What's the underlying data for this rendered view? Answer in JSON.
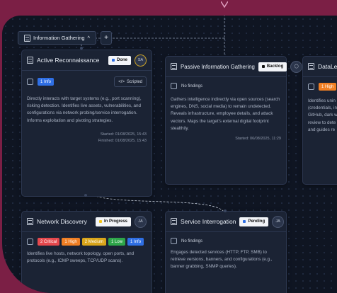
{
  "tab": {
    "label": "Information Gathering",
    "chevron": "^",
    "add": "+"
  },
  "cards": {
    "active": {
      "title": "Active Reconnaissance",
      "status": "Done",
      "avatar": "SA",
      "badge": "1 Info",
      "scripted": "Scripted",
      "desc": "Directly interacts with target systems (e.g., port scanning), risking detection. Identifies live assets, vulnerabilities, and configurations via network probing/service interrogation. Informs exploitation and pivoting strategies.",
      "started": "Started: 01/08/2025, 15:43",
      "finished": "Finished: 01/08/2025, 15:43"
    },
    "passive": {
      "title": "Passive Information Gathering",
      "status": "Backlog",
      "nofind": "No findings",
      "desc": "Gathers intelligence indirectly via open sources (search engines, DNS, social media) to remain undetected. Reveals infrastructure, employee details, and attack vectors. Maps the target's external digital footprint stealthily.",
      "started": "Started: 06/08/2025, 11:29"
    },
    "dataleak": {
      "title": "DataLeak",
      "badge": "1 High",
      "desc_lines": [
        "Identifies unin",
        "(credentials, in",
        "GitHub, dark w",
        "review to dete",
        "and guides re"
      ]
    },
    "network": {
      "title": "Network Discovery",
      "status": "In Progress",
      "avatar": "JA",
      "badges": [
        "2 Critical",
        "1 High",
        "2 Medium",
        "1 Low",
        "1 Info"
      ],
      "desc": "Identifies live hosts, network topology, open ports, and protocols (e.g., ICMP sweeps, TCP/UDP scans)."
    },
    "service": {
      "title": "Service Interrogation",
      "status": "Pending",
      "avatar": "JA",
      "nofind": "No findings",
      "desc": "Engages detected services (HTTP, FTP, SMB) to retrieve versions, banners, and configurations (e.g., banner grabbing, SNMP queries)."
    }
  },
  "colors": {
    "done": "#2f6fe4",
    "backlog": "#111111",
    "inprogress": "#f5c518",
    "pending": "#2f6fe4",
    "critical": "#e5484d",
    "high": "#f07f24",
    "medium": "#d9a51a",
    "low": "#2ea64a",
    "info": "#2f6fe4"
  }
}
